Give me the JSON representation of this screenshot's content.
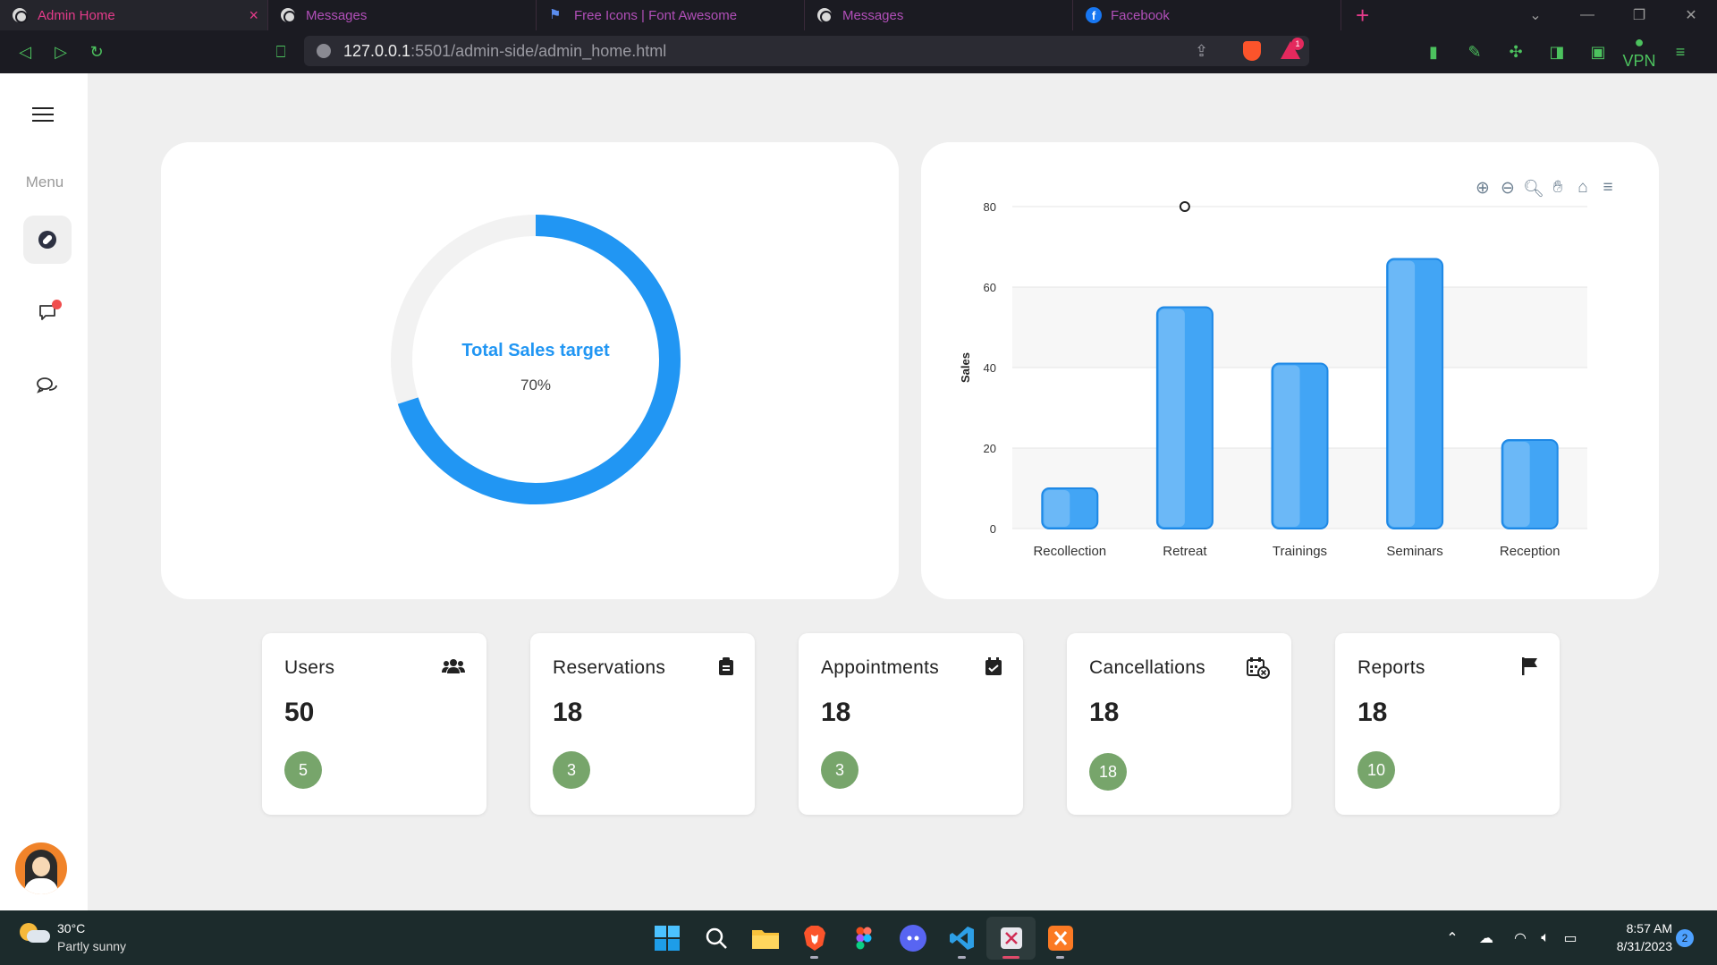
{
  "browser": {
    "tabs": [
      {
        "title": "Admin Home",
        "icon": "globe-icon",
        "active": true
      },
      {
        "title": "Messages",
        "icon": "globe-icon",
        "active": false
      },
      {
        "title": "Free Icons | Font Awesome",
        "icon": "flag-icon",
        "active": false
      },
      {
        "title": "Messages",
        "icon": "globe-icon",
        "active": false
      },
      {
        "title": "Facebook",
        "icon": "facebook-icon",
        "active": false
      }
    ],
    "new_tab": "+",
    "url_host": "127.0.0.1",
    "url_path": ":5501/admin-side/admin_home.html",
    "rewards_badge": "1",
    "vpn_label": "VPN"
  },
  "sidebar": {
    "menu_label": "Menu",
    "items": [
      {
        "name": "dashboard",
        "icon": "compass-icon",
        "active": true
      },
      {
        "name": "notifications",
        "icon": "chat-bubble-icon",
        "has_dot": true
      },
      {
        "name": "messages",
        "icon": "comments-icon"
      }
    ]
  },
  "donut": {
    "title": "Total Sales target",
    "value_label": "70%",
    "percent": 70,
    "colors": {
      "fill": "#2196f3",
      "track": "#f2f2f2"
    }
  },
  "chart_data": {
    "type": "bar",
    "categories": [
      "Recollection",
      "Retreat",
      "Trainings",
      "Seminars",
      "Reception"
    ],
    "values": [
      10,
      55,
      41,
      67,
      22
    ],
    "ylabel": "Sales",
    "xlabel": "",
    "ylim": [
      0,
      80
    ],
    "yticks": [
      0,
      20,
      40,
      60,
      80
    ],
    "grid": true,
    "bar_color": "#42a5f5"
  },
  "stats": [
    {
      "label": "Users",
      "value": "50",
      "badge": "5",
      "icon": "users-icon"
    },
    {
      "label": "Reservations",
      "value": "18",
      "badge": "3",
      "icon": "clipboard-icon"
    },
    {
      "label": "Appointments",
      "value": "18",
      "badge": "3",
      "icon": "calendar-check-icon"
    },
    {
      "label": "Cancellations",
      "value": "18",
      "badge": "18",
      "icon": "calendar-x-icon"
    },
    {
      "label": "Reports",
      "value": "18",
      "badge": "10",
      "icon": "flag-icon"
    }
  ],
  "taskbar": {
    "weather_temp": "30°C",
    "weather_desc": "Partly sunny",
    "time": "8:57 AM",
    "date": "8/31/2023",
    "notification_count": "2"
  }
}
